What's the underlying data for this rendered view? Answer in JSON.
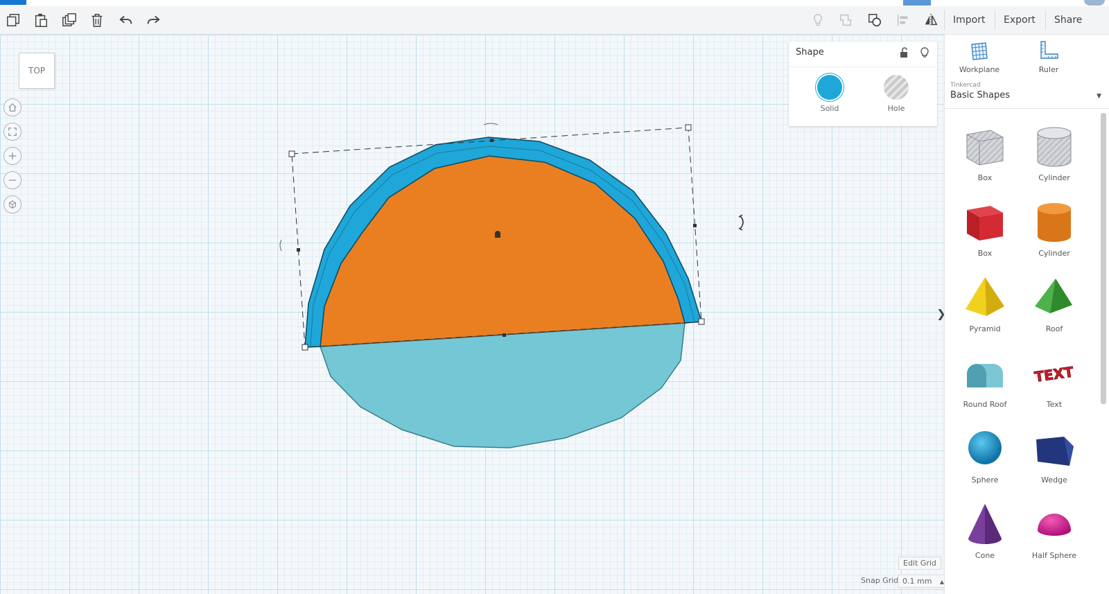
{
  "toolbar": {
    "import_label": "Import",
    "export_label": "Export",
    "share_label": "Share"
  },
  "viewcube": {
    "label": "TOP"
  },
  "shape_panel": {
    "title": "Shape",
    "solid_label": "Solid",
    "hole_label": "Hole",
    "solid_color": "#1fa7d9"
  },
  "grid": {
    "edit_label": "Edit Grid",
    "snap_label": "Snap Grid",
    "snap_value": "0.1 mm"
  },
  "sidebar": {
    "workplane_label": "Workplane",
    "ruler_label": "Ruler",
    "library_source": "Tinkercad",
    "library_name": "Basic Shapes",
    "shapes": [
      {
        "label": "Box",
        "icon": "box-hole-icon"
      },
      {
        "label": "Cylinder",
        "icon": "cylinder-hole-icon"
      },
      {
        "label": "Box",
        "icon": "box-icon"
      },
      {
        "label": "Cylinder",
        "icon": "cylinder-icon"
      },
      {
        "label": "Pyramid",
        "icon": "pyramid-icon"
      },
      {
        "label": "Roof",
        "icon": "roof-icon"
      },
      {
        "label": "Round Roof",
        "icon": "round-roof-icon"
      },
      {
        "label": "Text",
        "icon": "text-icon"
      },
      {
        "label": "Sphere",
        "icon": "sphere-icon"
      },
      {
        "label": "Wedge",
        "icon": "wedge-icon"
      },
      {
        "label": "Cone",
        "icon": "cone-icon"
      },
      {
        "label": "Half Sphere",
        "icon": "half-sphere-icon"
      }
    ],
    "text_shape_lettering": "TEXT"
  },
  "colors": {
    "orange_shape": "#ea7f22",
    "light_blue_shape": "#74c7d5",
    "selected_arc": "#1fa7d9",
    "accent": "#1677d2"
  }
}
